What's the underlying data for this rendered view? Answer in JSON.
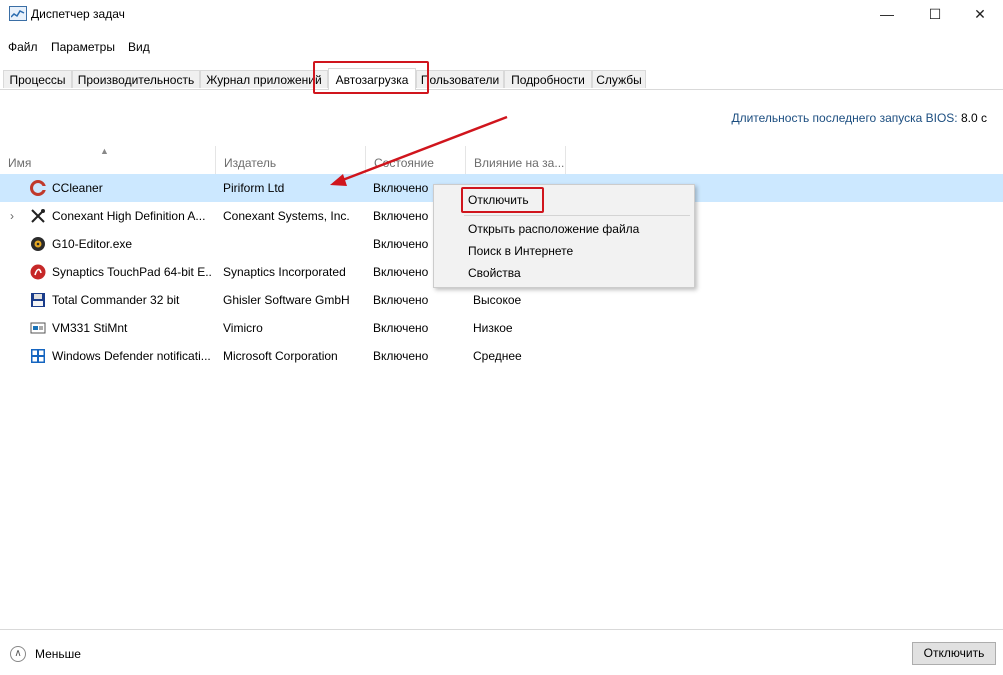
{
  "window": {
    "title": "Диспетчер задач",
    "minimize": "—",
    "maximize": "☐",
    "close": "✕"
  },
  "menu": [
    "Файл",
    "Параметры",
    "Вид"
  ],
  "tabs": [
    "Процессы",
    "Производительность",
    "Журнал приложений",
    "Автозагрузка",
    "Пользователи",
    "Подробности",
    "Службы"
  ],
  "active_tab": "Автозагрузка",
  "bios": {
    "label": "Длительность последнего запуска BIOS:",
    "value": "8.0 с"
  },
  "columns": {
    "name": "Имя",
    "publisher": "Издатель",
    "status": "Состояние",
    "impact": "Влияние на за..."
  },
  "rows": [
    {
      "name": "CCleaner",
      "publisher": "Piriform Ltd",
      "status": "Включено",
      "impact": "",
      "icon": "ccleaner-icon",
      "selected": true
    },
    {
      "name": "Conexant High Definition A...",
      "publisher": "Conexant Systems, Inc.",
      "status": "Включено",
      "impact": "",
      "icon": "tools-icon",
      "expandable": true
    },
    {
      "name": "G10-Editor.exe",
      "publisher": "",
      "status": "Включено",
      "impact": "",
      "icon": "gear-icon"
    },
    {
      "name": "Synaptics TouchPad 64-bit E...",
      "publisher": "Synaptics Incorporated",
      "status": "Включено",
      "impact": "",
      "icon": "synaptics-icon"
    },
    {
      "name": "Total Commander 32 bit",
      "publisher": "Ghisler Software GmbH",
      "status": "Включено",
      "impact": "Высокое",
      "icon": "floppy-icon"
    },
    {
      "name": "VM331 StiMnt",
      "publisher": "Vimicro",
      "status": "Включено",
      "impact": "Низкое",
      "icon": "camera-icon"
    },
    {
      "name": "Windows Defender notificati...",
      "publisher": "Microsoft Corporation",
      "status": "Включено",
      "impact": "Среднее",
      "icon": "defender-icon"
    }
  ],
  "context_menu": [
    "Отключить",
    "Открыть расположение файла",
    "Поиск в Интернете",
    "Свойства"
  ],
  "footer": {
    "less": "Меньше",
    "disable_button": "Отключить"
  },
  "accent": {
    "highlight": "#d0151d",
    "selection": "#cce8ff"
  }
}
